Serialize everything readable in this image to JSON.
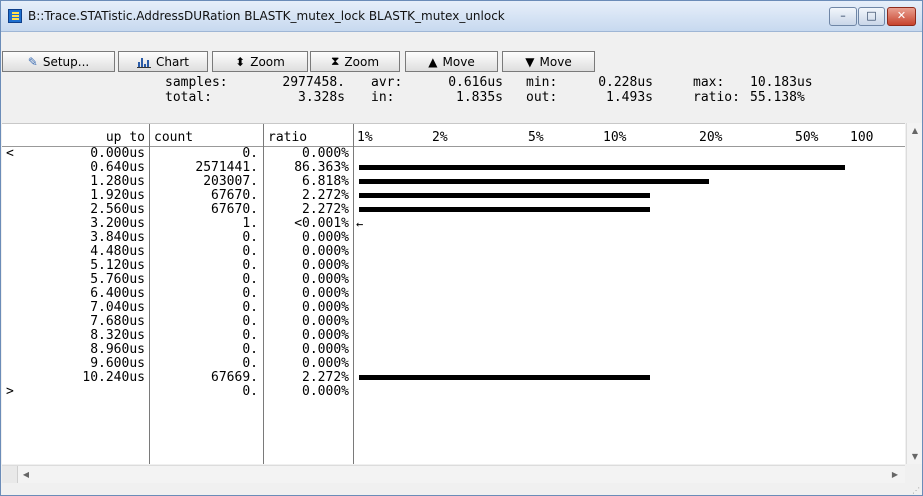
{
  "window": {
    "title": "B::Trace.STATistic.AddressDURation BLASTK_mutex_lock BLASTK_mutex_unlock",
    "min_glyph": "–",
    "max_glyph": "□",
    "close_glyph": "✕"
  },
  "toolbar": {
    "setup": "Setup...",
    "chart": "Chart",
    "zoom_in": "Zoom",
    "zoom_out": "Zoom",
    "move_up": "Move",
    "move_down": "Move"
  },
  "stats": {
    "samples_label": "samples:",
    "samples_value": "2977458.",
    "avr_label": "avr:",
    "avr_value": "0.616us",
    "min_label": "min:",
    "min_value": "0.228us",
    "max_label": "max:",
    "max_value": "10.183us",
    "total_label": "total:",
    "total_value": "3.328s",
    "in_label": "in:",
    "in_value": "1.835s",
    "out_label": "out:",
    "out_value": "1.493s",
    "ratio_label": "ratio:",
    "ratio_value": "55.138%"
  },
  "columns": {
    "up_to": "up to",
    "count": "count",
    "ratio": "ratio",
    "scale": [
      "1%",
      "2%",
      "5%",
      "10%",
      "20%",
      "50%",
      "100"
    ]
  },
  "rows": [
    {
      "mark": "<",
      "up_to": "0.000us",
      "count": "0.",
      "ratio": "0.000%",
      "percent": 0
    },
    {
      "mark": "",
      "up_to": "0.640us",
      "count": "2571441.",
      "ratio": "86.363%",
      "percent": 86.363
    },
    {
      "mark": "",
      "up_to": "1.280us",
      "count": "203007.",
      "ratio": "6.818%",
      "percent": 6.818
    },
    {
      "mark": "",
      "up_to": "1.920us",
      "count": "67670.",
      "ratio": "2.272%",
      "percent": 2.272
    },
    {
      "mark": "",
      "up_to": "2.560us",
      "count": "67670.",
      "ratio": "2.272%",
      "percent": 2.272
    },
    {
      "mark": "",
      "up_to": "3.200us",
      "count": "1.",
      "ratio": "<0.001%",
      "percent": 3e-05,
      "arrow": "←"
    },
    {
      "mark": "",
      "up_to": "3.840us",
      "count": "0.",
      "ratio": "0.000%",
      "percent": 0
    },
    {
      "mark": "",
      "up_to": "4.480us",
      "count": "0.",
      "ratio": "0.000%",
      "percent": 0
    },
    {
      "mark": "",
      "up_to": "5.120us",
      "count": "0.",
      "ratio": "0.000%",
      "percent": 0
    },
    {
      "mark": "",
      "up_to": "5.760us",
      "count": "0.",
      "ratio": "0.000%",
      "percent": 0
    },
    {
      "mark": "",
      "up_to": "6.400us",
      "count": "0.",
      "ratio": "0.000%",
      "percent": 0
    },
    {
      "mark": "",
      "up_to": "7.040us",
      "count": "0.",
      "ratio": "0.000%",
      "percent": 0
    },
    {
      "mark": "",
      "up_to": "7.680us",
      "count": "0.",
      "ratio": "0.000%",
      "percent": 0
    },
    {
      "mark": "",
      "up_to": "8.320us",
      "count": "0.",
      "ratio": "0.000%",
      "percent": 0
    },
    {
      "mark": "",
      "up_to": "8.960us",
      "count": "0.",
      "ratio": "0.000%",
      "percent": 0
    },
    {
      "mark": "",
      "up_to": "9.600us",
      "count": "0.",
      "ratio": "0.000%",
      "percent": 0
    },
    {
      "mark": "",
      "up_to": "10.240us",
      "count": "67669.",
      "ratio": "2.272%",
      "percent": 2.272
    },
    {
      "mark": ">",
      "up_to": "",
      "count": "0.",
      "ratio": "0.000%",
      "percent": 0
    }
  ],
  "icons": {
    "app": "trace-app-icon",
    "setup": "wrench-icon",
    "chart": "bar-chart-icon",
    "zoom_in": "expand-vertical-icon",
    "zoom_out": "compress-vertical-icon",
    "move_up": "arrow-up-icon",
    "move_down": "arrow-down-icon"
  }
}
